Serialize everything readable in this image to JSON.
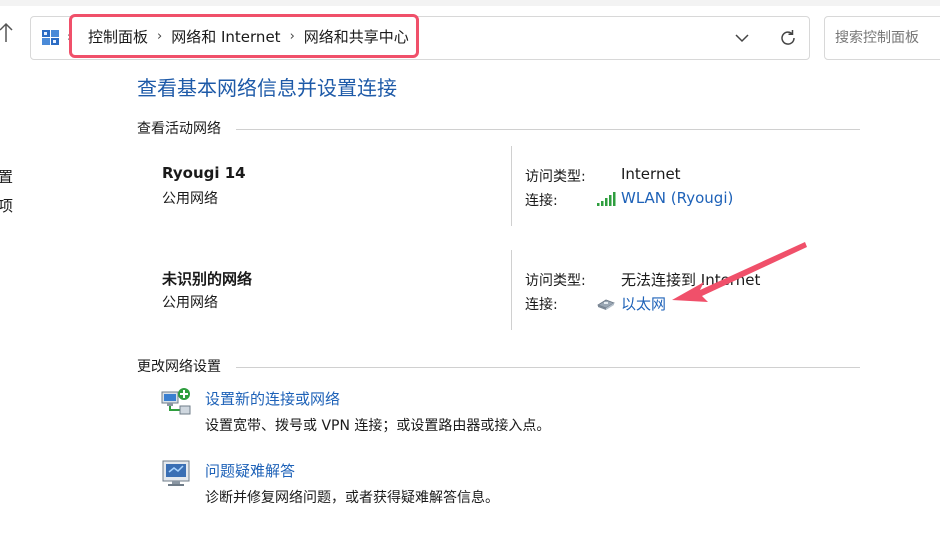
{
  "breadcrumb": {
    "items": [
      "控制面板",
      "网络和 Internet",
      "网络和共享中心"
    ]
  },
  "search": {
    "placeholder": "搜索控制面板"
  },
  "left_cut": {
    "item1": "置",
    "item2": "项"
  },
  "page": {
    "title": "查看基本网络信息并设置连接"
  },
  "active_networks": {
    "label": "查看活动网络",
    "networks": [
      {
        "name": "Ryougi 14",
        "category": "公用网络",
        "access_label": "访问类型:",
        "access_value": "Internet",
        "connection_label": "连接:",
        "connection_value": "WLAN (Ryougi)",
        "connection_icon": "wifi-signal-icon"
      },
      {
        "name": "未识别的网络",
        "category": "公用网络",
        "access_label": "访问类型:",
        "access_value": "无法连接到 Internet",
        "connection_label": "连接:",
        "connection_value": "以太网",
        "connection_icon": "ethernet-icon"
      }
    ]
  },
  "change_settings": {
    "label": "更改网络设置",
    "tasks": [
      {
        "link": "设置新的连接或网络",
        "desc": "设置宽带、拨号或 VPN 连接；或设置路由器或接入点。",
        "icon": "new-connection-icon"
      },
      {
        "link": "问题疑难解答",
        "desc": "诊断并修复网络问题，或者获得疑难解答信息。",
        "icon": "troubleshoot-icon"
      }
    ]
  },
  "colors": {
    "title_blue": "#1e5aa8",
    "link_blue": "#1e62b8",
    "highlight_red": "#f0506a"
  }
}
